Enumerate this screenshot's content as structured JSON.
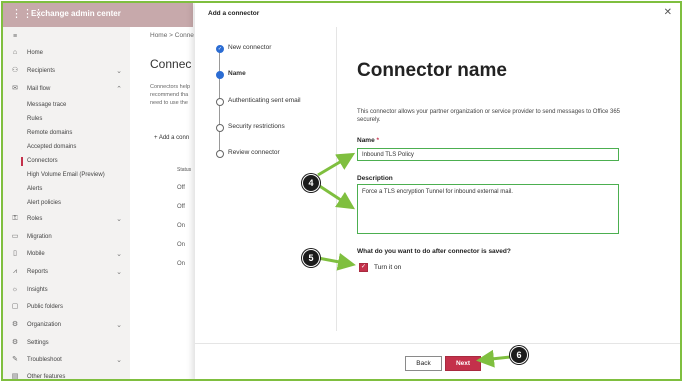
{
  "app": {
    "title": "Exchange admin center"
  },
  "nav": {
    "items": [
      {
        "label": "Home",
        "icon": "home-icon"
      },
      {
        "label": "Recipients",
        "icon": "person-icon"
      },
      {
        "label": "Mail flow",
        "icon": "mail-icon"
      },
      {
        "label": "Message trace"
      },
      {
        "label": "Rules"
      },
      {
        "label": "Remote domains"
      },
      {
        "label": "Accepted domains"
      },
      {
        "label": "Connectors"
      },
      {
        "label": "High Volume Email (Preview)"
      },
      {
        "label": "Alerts"
      },
      {
        "label": "Alert policies"
      },
      {
        "label": "Roles",
        "icon": "roles-icon"
      },
      {
        "label": "Migration",
        "icon": "migration-icon"
      },
      {
        "label": "Mobile",
        "icon": "mobile-icon"
      },
      {
        "label": "Reports",
        "icon": "reports-icon"
      },
      {
        "label": "Insights",
        "icon": "insights-icon"
      },
      {
        "label": "Public folders",
        "icon": "folder-icon"
      },
      {
        "label": "Organization",
        "icon": "organization-icon"
      },
      {
        "label": "Settings",
        "icon": "gear-icon"
      },
      {
        "label": "Troubleshoot",
        "icon": "troubleshoot-icon"
      },
      {
        "label": "Other features",
        "icon": "features-icon"
      }
    ]
  },
  "background": {
    "breadcrumb_home": "Home",
    "breadcrumb_sep": ">",
    "breadcrumb_current": "Conne",
    "heading": "Connec",
    "desc_lines": [
      "Connectors help",
      "recommend tha",
      "need to use the"
    ],
    "add_label": "+ Add a conn",
    "status_header": "Status",
    "statuses": [
      "Off",
      "Off",
      "On",
      "On",
      "On"
    ]
  },
  "panel": {
    "title": "Add a connector",
    "close": "✕",
    "steps": [
      {
        "label": "New connector",
        "state": "done"
      },
      {
        "label": "Name",
        "state": "current"
      },
      {
        "label": "Authenticating sent email",
        "state": "todo"
      },
      {
        "label": "Security restrictions",
        "state": "todo"
      },
      {
        "label": "Review connector",
        "state": "todo"
      }
    ],
    "heading": "Connector name",
    "intro": "This connector allows your partner organization or service provider to send messages to Office 365 securely.",
    "name_label": "Name",
    "required_mark": "*",
    "name_value": "Inbound TLS Policy",
    "description_label": "Description",
    "description_value": "Force a TLS encryption Tunnel for inbound external mail.",
    "question": "What do you want to do after connector is saved?",
    "turn_on_label": "Turn it on",
    "turn_on_checked": true,
    "back_label": "Back",
    "next_label": "Next"
  },
  "annotations": {
    "m4": "4",
    "m5": "5",
    "m6": "6"
  },
  "colors": {
    "accent": "#c4314b",
    "highlight": "#4caf50",
    "appbar": "#c7a9ab",
    "step_blue": "#2b6cd3"
  }
}
